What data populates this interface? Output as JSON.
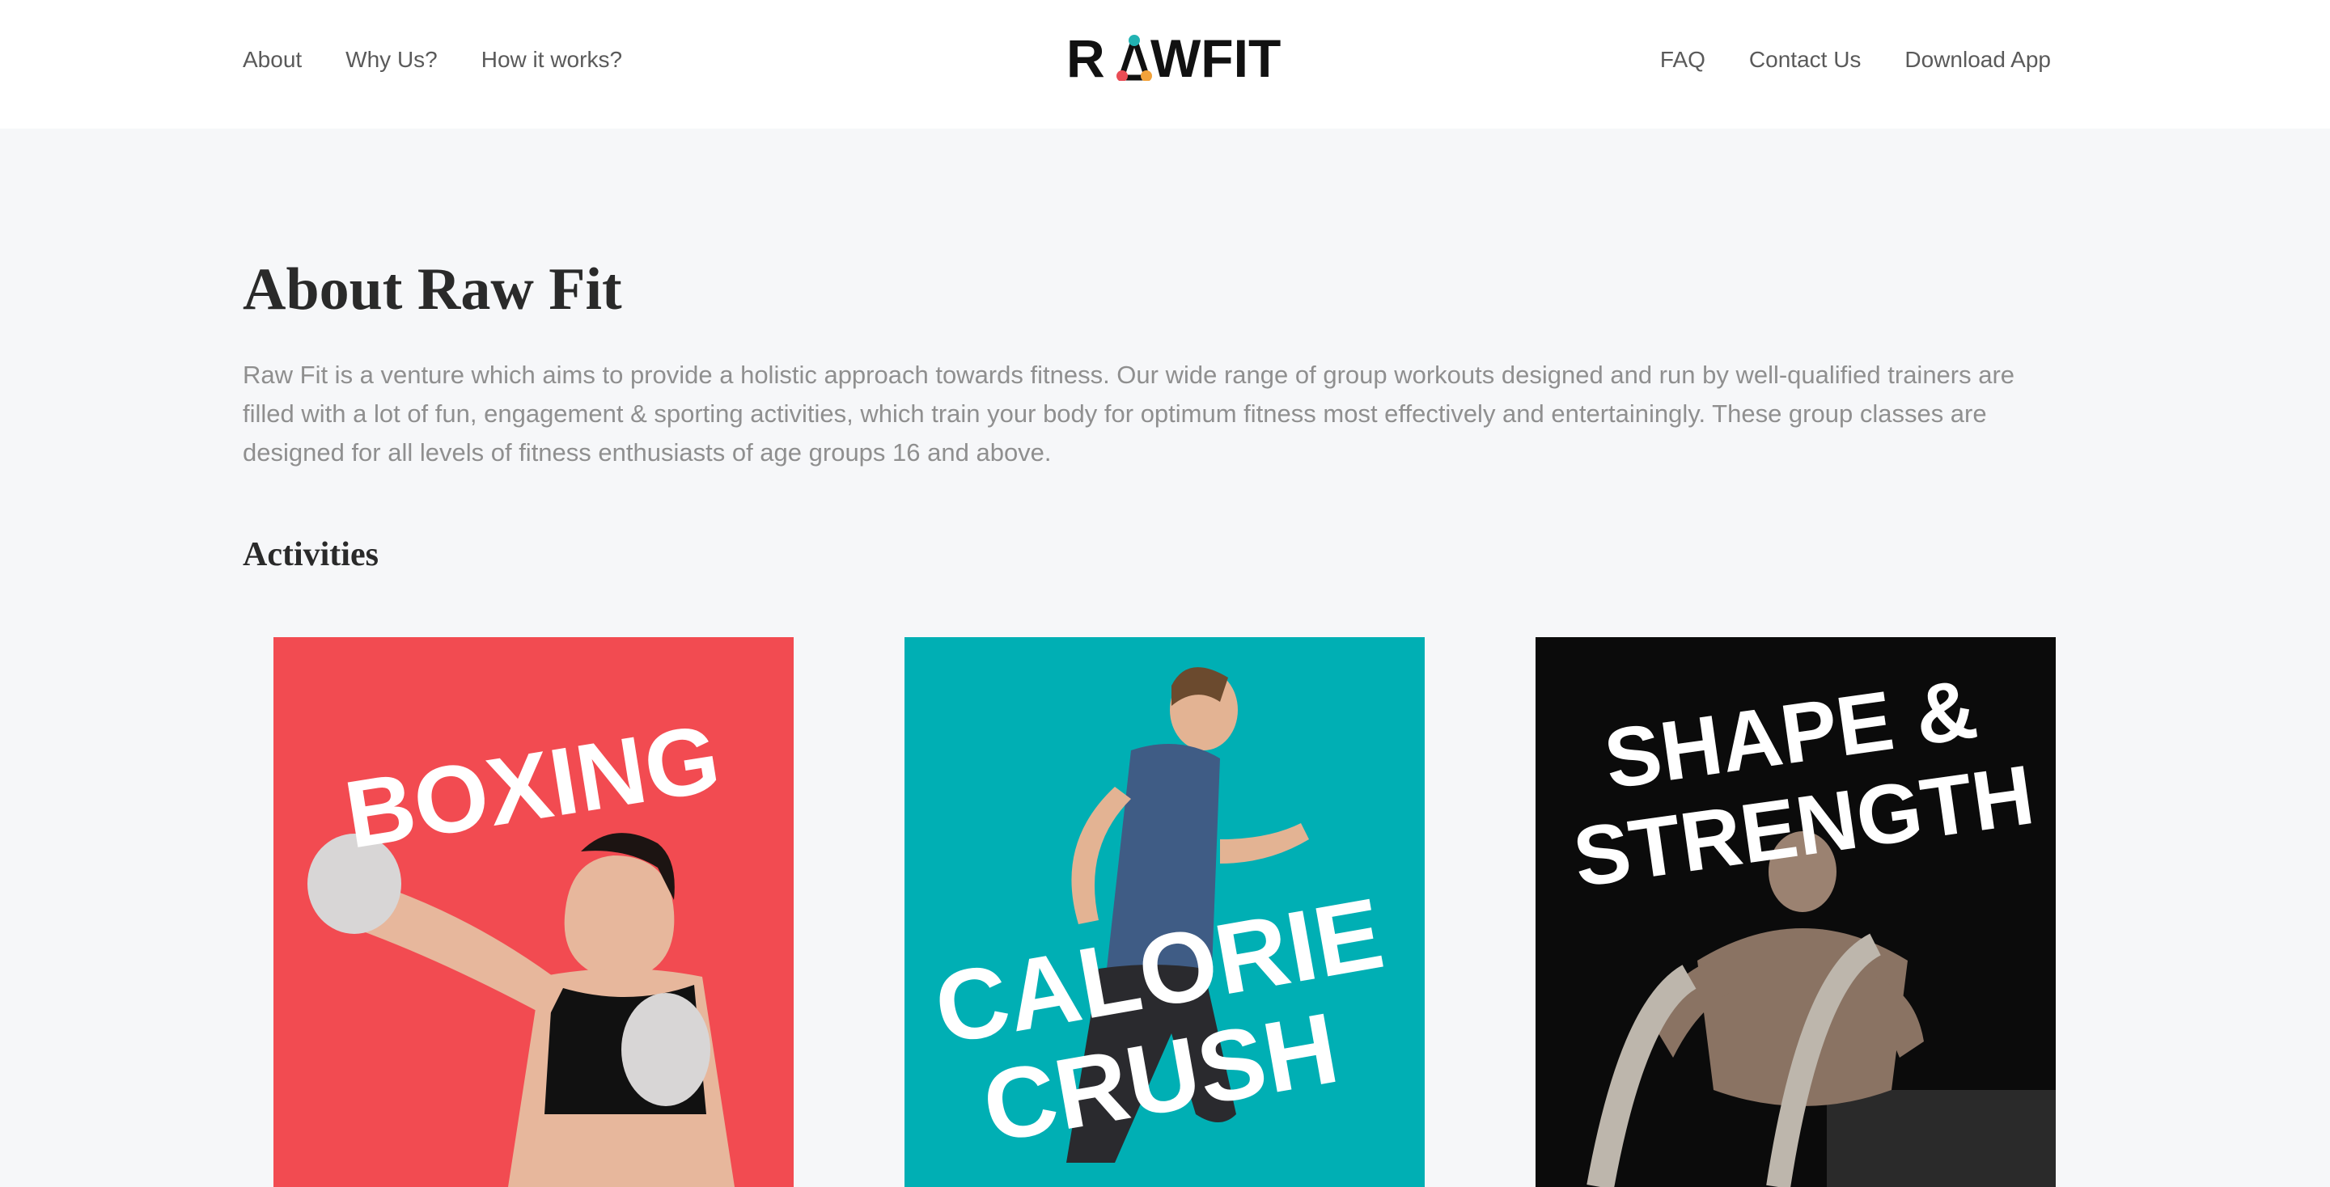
{
  "header": {
    "nav_left": [
      {
        "label": "About"
      },
      {
        "label": "Why Us?"
      },
      {
        "label": "How it works?"
      }
    ],
    "logo_text": "RAWFIT",
    "nav_right": [
      {
        "label": "FAQ"
      },
      {
        "label": "Contact Us"
      },
      {
        "label": "Download App"
      }
    ]
  },
  "main": {
    "title": "About Raw Fit",
    "intro": "Raw Fit is a venture which aims to provide a holistic approach towards fitness. Our wide range of group workouts designed and run by well-qualified trainers are filled with a lot of fun, engagement & sporting activities, which train your body for optimum fitness most effectively and entertainingly. These group classes are designed for all levels of fitness enthusiasts of age groups 16 and above.",
    "activities_title": "Activities",
    "activities": [
      {
        "title_line1": "BOXING",
        "title_line2": "",
        "color": "#f24b51"
      },
      {
        "title_line1": "CALORIE",
        "title_line2": "CRUSH",
        "color": "#00afb4"
      },
      {
        "title_line1": "SHAPE &",
        "title_line2": "STRENGTH",
        "color": "#0b0b0b"
      }
    ]
  },
  "colors": {
    "background": "#f6f7f9",
    "header": "#ffffff",
    "text_muted": "#8f8f8f",
    "logo_red": "#e94c55",
    "logo_teal": "#22b3b3",
    "logo_orange": "#f2a23a"
  }
}
